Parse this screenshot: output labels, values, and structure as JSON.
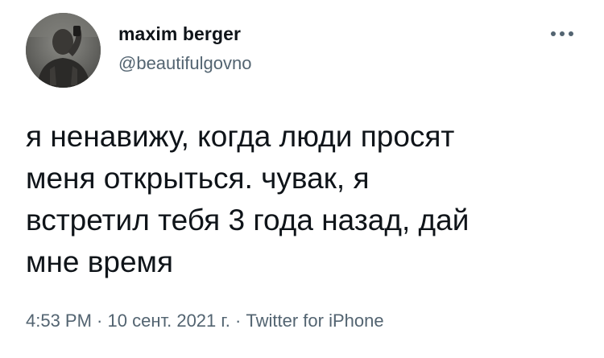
{
  "author": {
    "display_name": "maxim berger",
    "handle": "@beautifulgovno",
    "avatar_icon": "user-avatar-photo"
  },
  "more_icon": "more-horizontal-icon",
  "tweet": {
    "lines": [
      "я ненавижу, когда люди просят",
      "меня открыться. чувак, я",
      "встретил тебя 3 года назад, дай",
      "мне время"
    ]
  },
  "meta": {
    "time": "4:53 PM",
    "separator1": " · ",
    "date": "10 сент. 2021 г.",
    "separator2": " · ",
    "source": "Twitter for iPhone"
  },
  "colors": {
    "text_primary": "#0f1419",
    "text_secondary": "#536471",
    "background": "#ffffff"
  }
}
